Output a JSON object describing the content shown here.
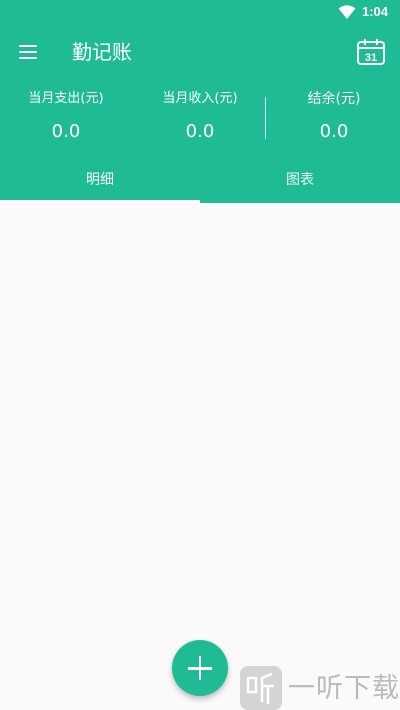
{
  "status_bar": {
    "time": "1:04",
    "wifi_icon": "wifi-icon"
  },
  "toolbar": {
    "menu_icon": "menu-icon",
    "title": "勤记账",
    "calendar_icon": "calendar-icon",
    "calendar_day": "31"
  },
  "summary": {
    "expense_label": "当月支出(元)",
    "expense_value": "0.0",
    "income_label": "当月收入(元)",
    "income_value": "0.0",
    "balance_label": "结余(元)",
    "balance_value": "0.0"
  },
  "tabs": [
    {
      "label": "明细",
      "selected": true
    },
    {
      "label": "图表",
      "selected": false
    }
  ],
  "fab": {
    "icon": "plus-icon"
  },
  "watermark": {
    "text": "一听下载"
  },
  "colors": {
    "primary": "#1ebb95",
    "background": "#fafafa",
    "on_primary": "#ffffff"
  }
}
